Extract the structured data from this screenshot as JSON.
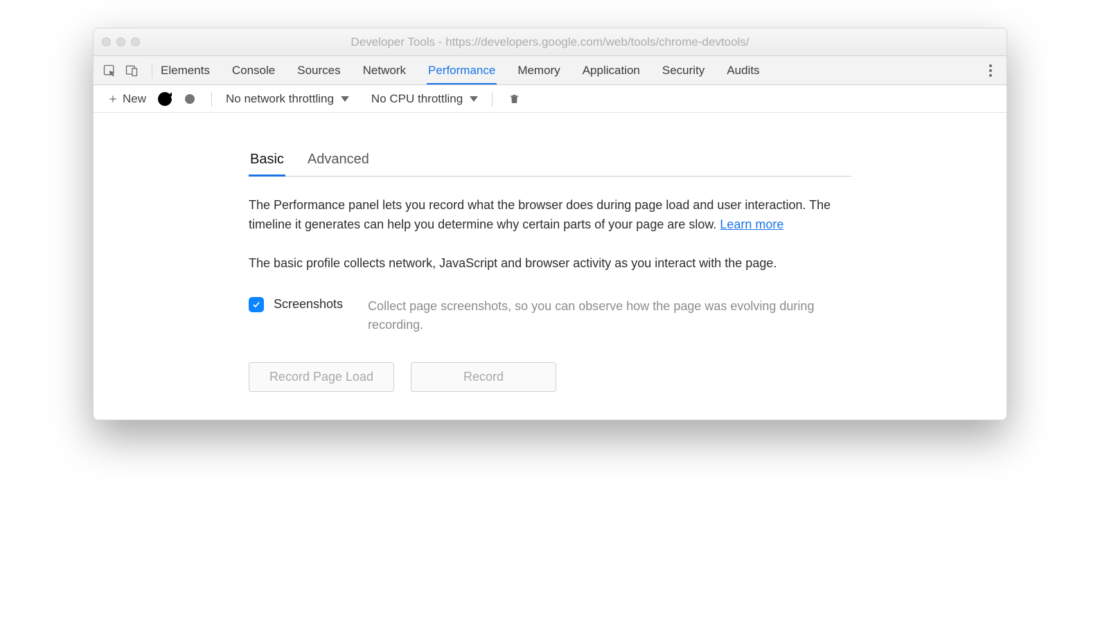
{
  "window": {
    "title": "Developer Tools - https://developers.google.com/web/tools/chrome-devtools/"
  },
  "tabs": {
    "items": [
      "Elements",
      "Console",
      "Sources",
      "Network",
      "Performance",
      "Memory",
      "Application",
      "Security",
      "Audits"
    ],
    "active_index": 4
  },
  "toolbar": {
    "new_label": "New",
    "network_throttle": "No network throttling",
    "cpu_throttle": "No CPU throttling"
  },
  "panel": {
    "subtabs": [
      "Basic",
      "Advanced"
    ],
    "subtab_active_index": 0,
    "description_1a": "The Performance panel lets you record what the browser does during page load and user interaction. The timeline it generates can help you determine why certain parts of your page are slow.  ",
    "learn_more": "Learn more",
    "description_2": "The basic profile collects network, JavaScript and browser activity as you interact with the page.",
    "option": {
      "checked": true,
      "label": "Screenshots",
      "description": "Collect page screenshots, so you can observe how the page was evolving during recording."
    },
    "buttons": {
      "record_page_load": "Record Page Load",
      "record": "Record"
    }
  }
}
